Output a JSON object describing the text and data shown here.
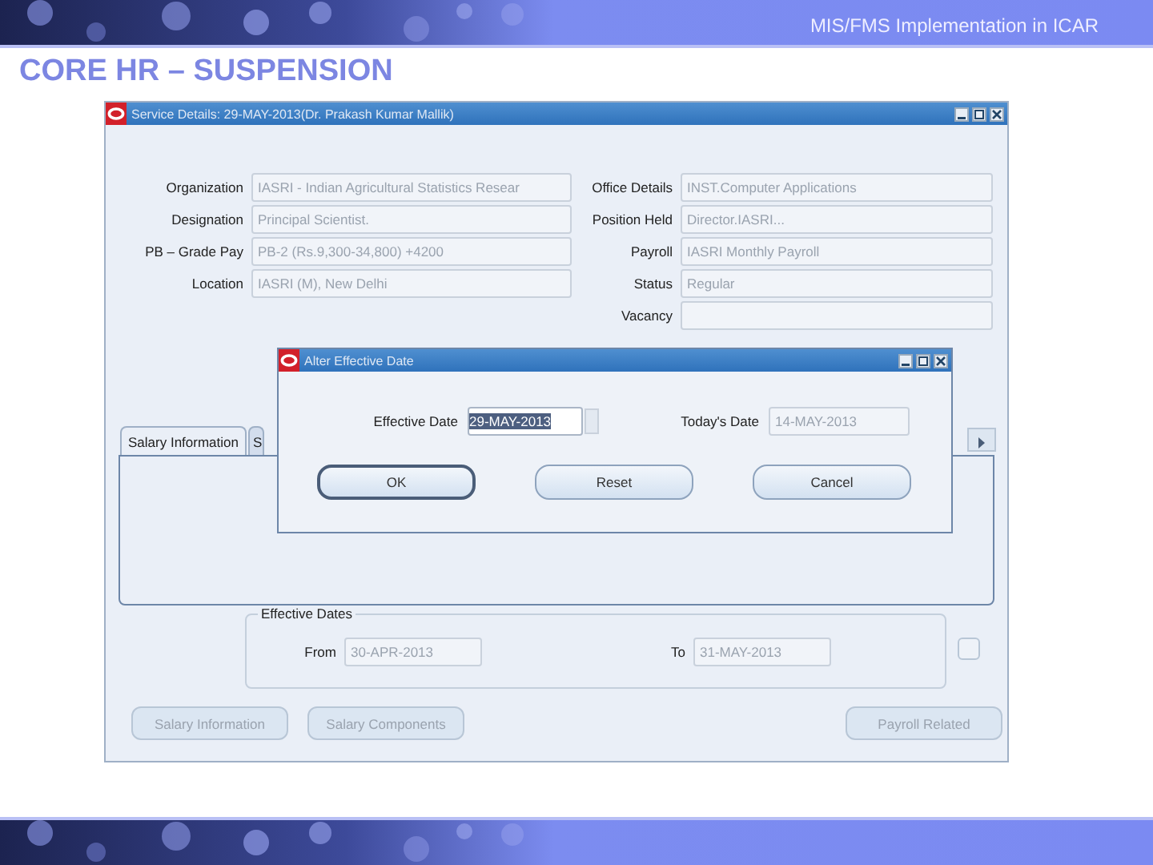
{
  "slide": {
    "header": "MIS/FMS Implementation in ICAR",
    "title": "CORE HR – SUSPENSION"
  },
  "window": {
    "title": "Service Details: 29-MAY-2013(Dr. Prakash Kumar Mallik)",
    "left_fields": [
      {
        "label": "Organization",
        "value": "IASRI - Indian Agricultural Statistics Resear"
      },
      {
        "label": "Designation",
        "value": "Principal Scientist."
      },
      {
        "label": "PB – Grade Pay",
        "value": "PB-2 (Rs.9,300-34,800) +4200"
      },
      {
        "label": "Location",
        "value": "IASRI (M), New Delhi"
      }
    ],
    "right_fields": [
      {
        "label": "Office Details",
        "value": "INST.Computer Applications"
      },
      {
        "label": "Position Held",
        "value": "Director.IASRI..."
      },
      {
        "label": "Payroll",
        "value": "IASRI Monthly Payroll"
      },
      {
        "label": "Status",
        "value": "Regular"
      },
      {
        "label": "Vacancy"
      }
    ],
    "tabs": [
      {
        "label": "Salary Information",
        "selected": true
      },
      {
        "label": "S",
        "selected": false
      }
    ],
    "effective_dates": {
      "legend": "Effective Dates",
      "from_label": "From",
      "from": "30-APR-2013",
      "to_label": "To",
      "to": "31-MAY-2013"
    },
    "checkbox": {
      "checked": false
    },
    "buttons": [
      {
        "label": "Salary Information",
        "disabled": true
      },
      {
        "label": "Salary Components",
        "disabled": true
      },
      {
        "label": "Payroll Related",
        "disabled": true
      }
    ]
  },
  "dialog": {
    "title": "Alter Effective Date",
    "effective_label": "Effective Date",
    "effective_value": "29-MAY-2013",
    "today_label": "Today's Date",
    "today_value": "14-MAY-2013",
    "buttons": [
      {
        "label": "OK",
        "focused": true
      },
      {
        "label": "Reset",
        "focused": false
      },
      {
        "label": "Cancel",
        "focused": false
      }
    ]
  }
}
